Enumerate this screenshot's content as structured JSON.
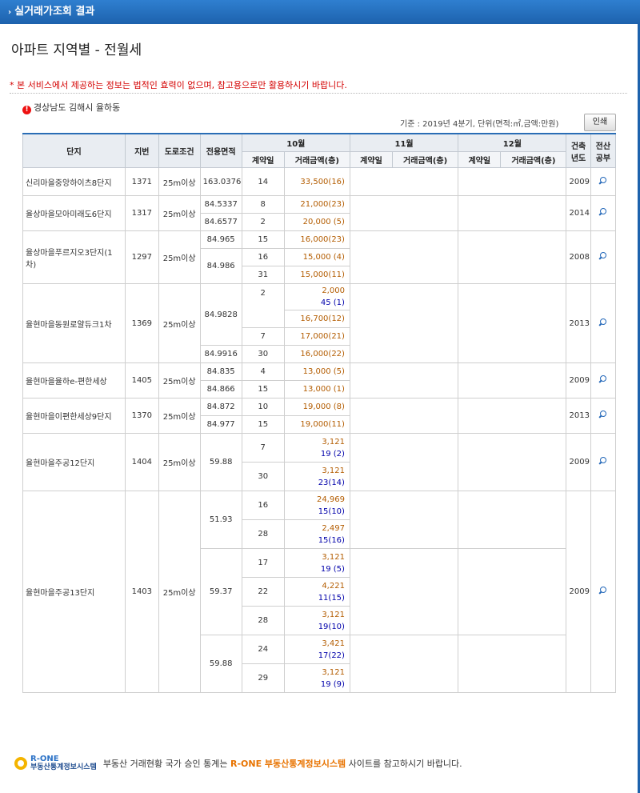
{
  "header": {
    "title": "실거래가조회 결과"
  },
  "page_title": "아파트 지역별 - 전월세",
  "notice": "* 본 서비스에서 제공하는 정보는 법적인 효력이 없으며, 참고용으로만 활용하시기 바랍니다.",
  "region": "경상남도 김해시 율하동",
  "criteria": "기준 : 2019년 4분기, 단위(면적:㎡,금액:만원)",
  "print_label": "인쇄",
  "columns": {
    "complex": "단지",
    "lot": "지번",
    "road": "도로조건",
    "area": "전용면적",
    "m10": "10월",
    "m11": "11월",
    "m12": "12월",
    "contract_day": "계약일",
    "amount": "거래금액(층)",
    "built": "건축년도",
    "ledger": "전산공부"
  },
  "rows": {
    "r1": {
      "name": "신리마을중앙하이츠8단지",
      "lot": "1371",
      "road": "25m이상",
      "area": "163.0376",
      "day": "14",
      "amt": "33,500(16)",
      "built": "2009"
    },
    "r2": {
      "name": "율상마을모아미래도6단지",
      "lot": "1317",
      "road": "25m이상",
      "a1": "84.5337",
      "d1": "8",
      "m1": "21,000(23)",
      "a2": "84.6577",
      "d2": "2",
      "m2": "20,000 (5)",
      "built": "2014"
    },
    "r3": {
      "name": "율상마을푸르지오3단지(1차)",
      "lot": "1297",
      "road": "25m이상",
      "a1": "84.965",
      "d1": "15",
      "m1": "16,000(23)",
      "a2": "84.986",
      "d2": "16",
      "m2": "15,000 (4)",
      "d3": "31",
      "m3": "15,000(11)",
      "built": "2008"
    },
    "r4": {
      "name": "율현마을동원로얄듀크1차",
      "lot": "1369",
      "road": "25m이상",
      "a1": "84.9828",
      "d1": "2",
      "m1a": "2,000",
      "m1b": "45 (1)",
      "m2": "16,700(12)",
      "d3": "7",
      "m3": "17,000(21)",
      "a2": "84.9916",
      "d4": "30",
      "m4": "16,000(22)",
      "built": "2013"
    },
    "r5": {
      "name": "율현마을율하e-편한세상",
      "lot": "1405",
      "road": "25m이상",
      "a1": "84.835",
      "d1": "4",
      "m1": "13,000 (5)",
      "a2": "84.866",
      "d2": "15",
      "m2": "13,000 (1)",
      "built": "2009"
    },
    "r6": {
      "name": "율현마을이편한세상9단지",
      "lot": "1370",
      "road": "25m이상",
      "a1": "84.872",
      "d1": "10",
      "m1": "19,000 (8)",
      "a2": "84.977",
      "d2": "15",
      "m2": "19,000(11)",
      "built": "2013"
    },
    "r7": {
      "name": "율현마을주공12단지",
      "lot": "1404",
      "road": "25m이상",
      "area": "59.88",
      "d1": "7",
      "m1a": "3,121",
      "m1b": "19 (2)",
      "d2": "30",
      "m2a": "3,121",
      "m2b": "23(14)",
      "built": "2009"
    },
    "r8": {
      "name": "율현마을주공13단지",
      "lot": "1403",
      "road": "25m이상",
      "a1": "51.93",
      "d1": "16",
      "m1a": "24,969",
      "m1b": "15(10)",
      "d2": "28",
      "m2a": "2,497",
      "m2b": "15(16)",
      "a2": "59.37",
      "d3": "17",
      "m3a": "3,121",
      "m3b": "19 (5)",
      "d4": "22",
      "m4a": "4,221",
      "m4b": "11(15)",
      "d5": "28",
      "m5a": "3,121",
      "m5b": "19(10)",
      "a3": "59.88",
      "d6": "24",
      "m6a": "3,421",
      "m6b": "17(22)",
      "d7": "29",
      "m7a": "3,121",
      "m7b": "19 (9)",
      "built": "2009"
    }
  },
  "footer": {
    "logo_brand": "R-ONE",
    "logo_sub": "부동산통계정보시스템",
    "text_before": "부동산 거래현황 국가 승인 통계는",
    "highlight": "R-ONE 부동산통계정보시스템",
    "text_after": "사이트를 참고하시기 바랍니다."
  }
}
